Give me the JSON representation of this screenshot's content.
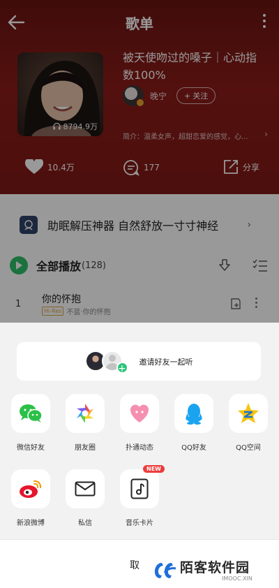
{
  "header": {
    "title": "歌单",
    "playlist_title": "被天使吻过的嗓子｜心动指数100%",
    "play_count": "8794.9万",
    "creator_name": "晚宁",
    "follow_label": "关注",
    "intro": "简介：温柔女声，超甜恋爱的感觉，心...",
    "likes": "10.4万",
    "comments": "177",
    "share_label": "分享"
  },
  "list": {
    "banner_text": "助眠解压神器 自然舒放一寸寸神经",
    "play_all_label": "全部播放",
    "song_count": "(128)",
    "songs": [
      {
        "index": "1",
        "name": "你的怀抱",
        "quality": "Hi-Res",
        "sub": "不蓝·你的怀抱"
      }
    ]
  },
  "share_sheet": {
    "invite_label": "邀请好友一起听",
    "targets": [
      {
        "label": "微信好友",
        "icon": "wechat-icon"
      },
      {
        "label": "朋友圈",
        "icon": "moments-icon"
      },
      {
        "label": "扑通动态",
        "icon": "putong-icon"
      },
      {
        "label": "QQ好友",
        "icon": "qq-icon"
      },
      {
        "label": "QQ空间",
        "icon": "qzone-icon"
      },
      {
        "label": "新浪微博",
        "icon": "weibo-icon"
      },
      {
        "label": "私信",
        "icon": "message-icon"
      },
      {
        "label": "音乐卡片",
        "icon": "music-card-icon"
      }
    ],
    "new_badge": "NEW",
    "cancel_label": "取消"
  },
  "watermark": {
    "text": "陌客软件园",
    "sub": "IMOOC.XIN"
  },
  "colors": {
    "header_red": "#8a1c18",
    "play_green": "#2fbf6a",
    "wechat_green": "#2bc048",
    "qq_blue": "#1aa4f0",
    "qzone_yellow": "#f6c410",
    "weibo_red": "#e6162d",
    "badge_red": "#ee3b3b"
  }
}
